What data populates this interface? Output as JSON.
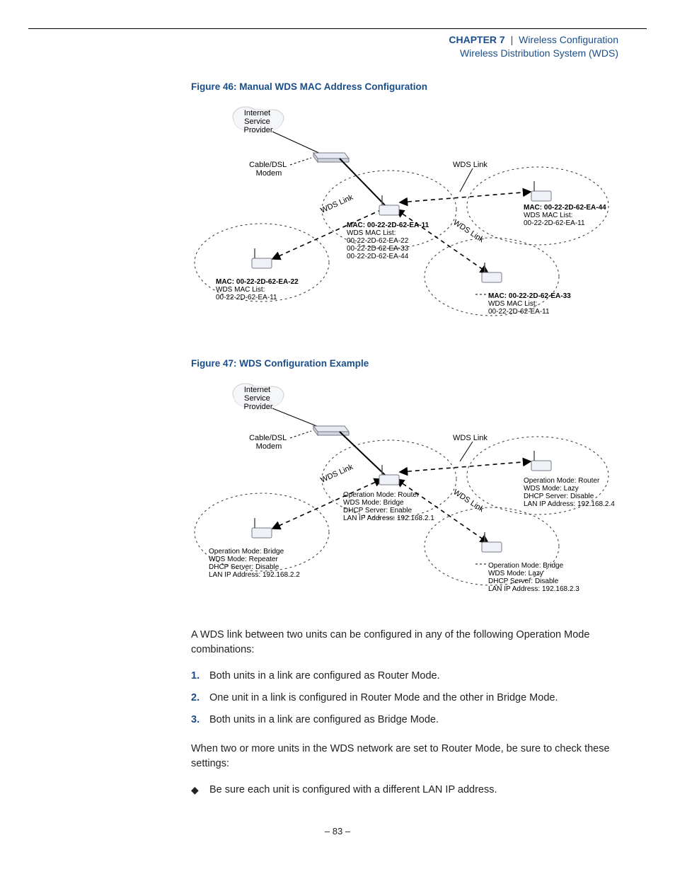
{
  "header": {
    "chapter": "Chapter 7",
    "separator": "|",
    "tail1": "Wireless Configuration",
    "line2": "Wireless Distribution System (WDS)"
  },
  "figures": {
    "f46": {
      "caption": "Figure 46:  Manual WDS MAC Address Configuration",
      "isp": "Internet\nService\nProvider",
      "modem_l1": "Cable/DSL",
      "modem_l2": "Modem",
      "wds_link": "WDS Link",
      "node_center": {
        "mac": "MAC: 00-22-2D-62-EA-11",
        "listlabel": "WDS MAC List:",
        "l1": "00-22-2D-62-EA-22",
        "l2": "00-22-2D-62-EA-33",
        "l3": "00-22-2D-62-EA-44"
      },
      "node_left": {
        "mac": "MAC: 00-22-2D-62-EA-22",
        "listlabel": "WDS MAC List:",
        "l1": "00-22-2D-62-EA-11"
      },
      "node_right_top": {
        "mac": "MAC: 00-22-2D-62-EA-44",
        "listlabel": "WDS MAC List:",
        "l1": "00-22-2D-62-EA-11"
      },
      "node_right_bot": {
        "mac": "MAC: 00-22-2D-62-EA-33",
        "listlabel": "WDS MAC List:",
        "l1": "00-22-2D-62-EA-11"
      }
    },
    "f47": {
      "caption": "Figure 47:  WDS Configuration Example",
      "isp": "Internet\nService\nProvider",
      "modem_l1": "Cable/DSL",
      "modem_l2": "Modem",
      "wds_link": "WDS Link",
      "node_center": {
        "l1": "Operation Mode: Router",
        "l2": "WDS Mode: Bridge",
        "l3": "DHCP Server: Enable",
        "l4": "LAN IP Address: 192.168.2.1"
      },
      "node_left": {
        "l1": "Operation Mode: Bridge",
        "l2": "WDS Mode: Repeater",
        "l3": "DHCP Server: Disable",
        "l4": "LAN IP Address: 192.168.2.2"
      },
      "node_right_top": {
        "l1": "Operation Mode: Router",
        "l2": "WDS Mode: Lazy",
        "l3": "DHCP Server: Disable",
        "l4": "LAN IP Address: 192.168.2.4"
      },
      "node_right_bot": {
        "l1": "Operation Mode: Bridge",
        "l2": "WDS Mode: Lazy",
        "l3": "DHCP Server: Disable",
        "l4": "LAN IP Address: 192.168.2.3"
      }
    }
  },
  "body": {
    "p1": "A WDS link between two units can be configured in any of the following Operation Mode combinations:",
    "list": {
      "n1": "1.",
      "t1": "Both units in a link are configured as Router Mode.",
      "n2": "2.",
      "t2": "One unit in a link is configured in Router Mode and the other in Bridge Mode.",
      "n3": "3.",
      "t3": "Both units in a link are configured as Bridge Mode."
    },
    "p2": "When two or more units in the WDS network are set to Router Mode, be sure to check these settings:",
    "bullet1": "Be sure each unit is configured with a different LAN IP address."
  },
  "footer": {
    "page": "–  83  –"
  }
}
